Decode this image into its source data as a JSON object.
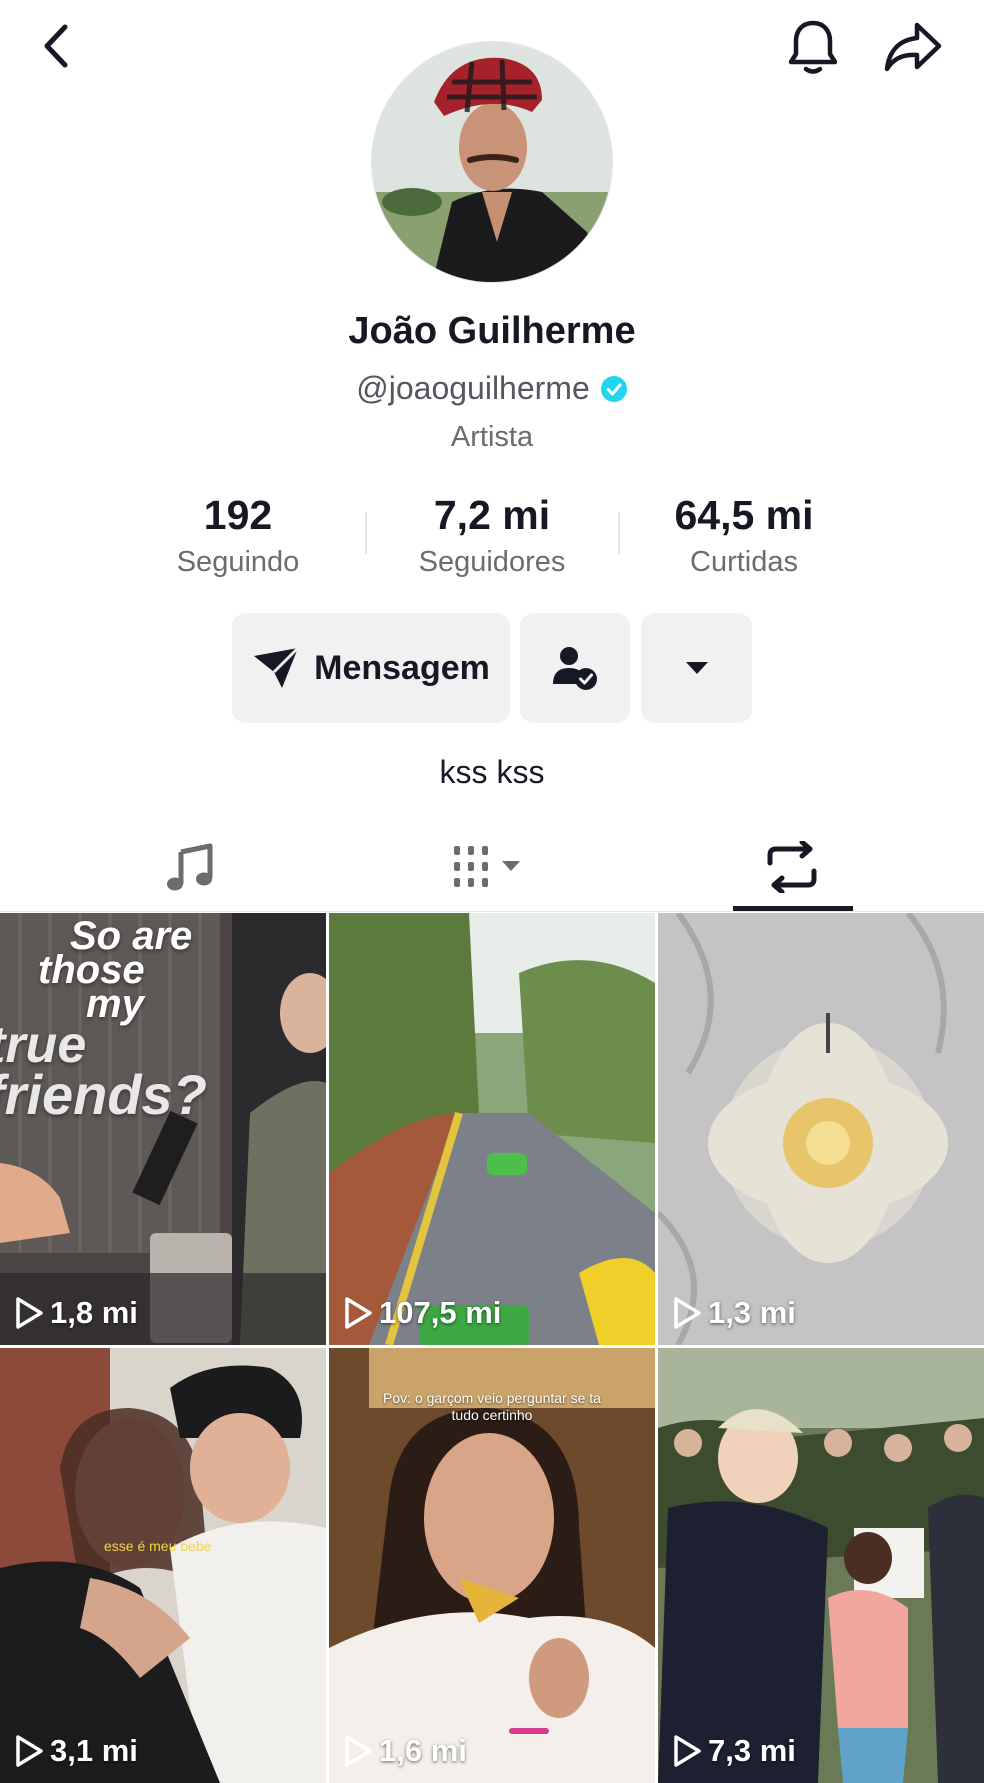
{
  "profile": {
    "name": "João Guilherme",
    "handle": "@joaoguilherme",
    "verified": true,
    "category": "Artista",
    "bio": "kss kss"
  },
  "stats": [
    {
      "value": "192",
      "label": "Seguindo"
    },
    {
      "value": "7,2 mi",
      "label": "Seguidores"
    },
    {
      "value": "64,5 mi",
      "label": "Curtidas"
    }
  ],
  "actions": {
    "message_label": "Mensagem"
  },
  "icons": {
    "back": "chevron-left-icon",
    "notifications": "bell-icon",
    "share": "share-arrow-icon",
    "message": "send-icon",
    "following": "user-check-icon",
    "more": "caret-down-icon",
    "tab_music": "music-note-icon",
    "tab_videos": "grid-icon",
    "tab_reposts": "repost-icon",
    "play": "play-icon"
  },
  "colors": {
    "verified_badge": "#20d5ec",
    "button_bg": "#f1f1f2",
    "text_primary": "#161823",
    "text_secondary": "#6b6c72"
  },
  "tabs": [
    {
      "id": "music",
      "active": false
    },
    {
      "id": "videos",
      "active": false
    },
    {
      "id": "reposts",
      "active": true
    }
  ],
  "videos": [
    {
      "views": "1,8 mi",
      "overlay": [
        "So are",
        "those",
        "my",
        "true",
        "friends?"
      ]
    },
    {
      "views": "107,5 mi"
    },
    {
      "views": "1,3 mi"
    },
    {
      "views": "3,1 mi",
      "overlay": [
        "esse é meu bebe"
      ]
    },
    {
      "views": "1,6 mi",
      "overlay": [
        "Pov: o garçom veio perguntar se ta",
        "tudo certinho"
      ]
    },
    {
      "views": "7,3 mi"
    }
  ]
}
